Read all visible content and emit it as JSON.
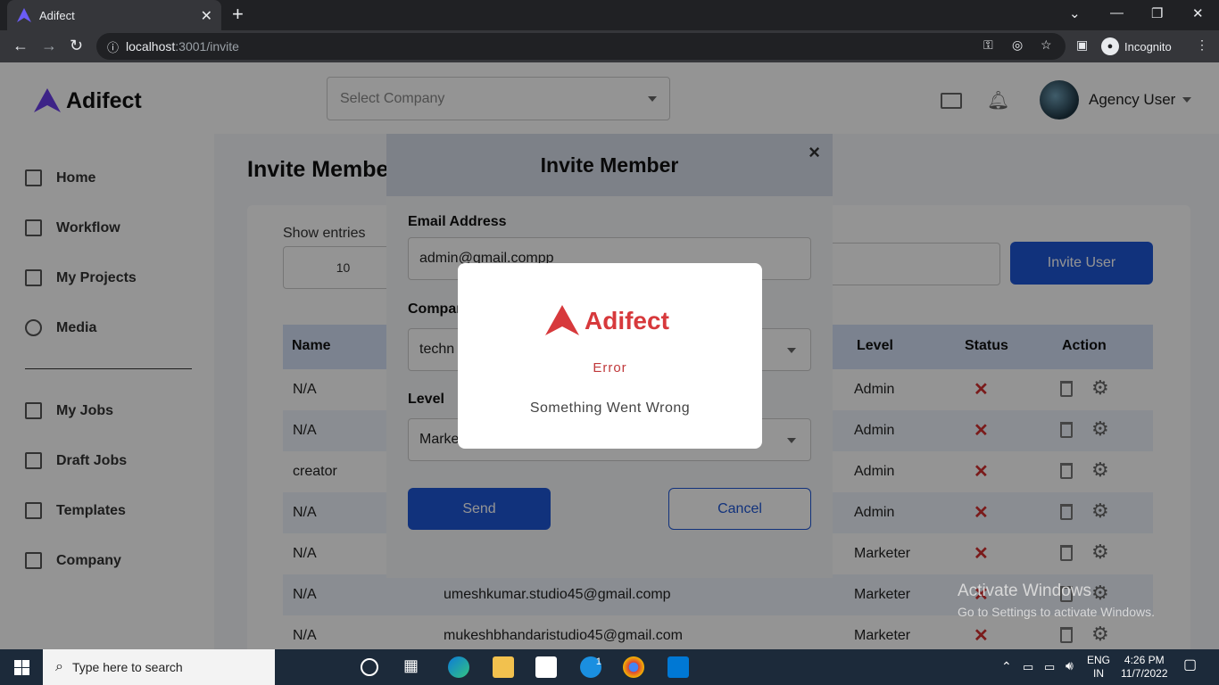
{
  "browser": {
    "tab_title": "Adifect",
    "url_host": "localhost",
    "url_path": ":3001/invite",
    "incognito_label": "Incognito"
  },
  "app": {
    "brand": "Adifect",
    "company_placeholder": "Select Company",
    "user_name": "Agency User",
    "sidebar": {
      "items": [
        "Home",
        "Workflow",
        "My Projects",
        "Media",
        "My Jobs",
        "Draft Jobs",
        "Templates",
        "Company"
      ]
    },
    "page_title": "Invite Member",
    "show_entries_label": "Show entries",
    "entries_value": "10",
    "invite_user_label": "Invite User",
    "table": {
      "headers": [
        "Name",
        "Level",
        "Status",
        "Action"
      ],
      "rows": [
        {
          "name": "N/A",
          "email": "",
          "level": "Admin"
        },
        {
          "name": "N/A",
          "email": "",
          "level": "Admin"
        },
        {
          "name": "creator",
          "email": "",
          "level": "Admin"
        },
        {
          "name": "N/A",
          "email": "",
          "level": "Admin"
        },
        {
          "name": "N/A",
          "email": "",
          "level": "Marketer"
        },
        {
          "name": "N/A",
          "email": "umeshkumar.studio45@gmail.comp",
          "level": "Marketer"
        },
        {
          "name": "N/A",
          "email": "mukeshbhandaristudio45@gmail.com",
          "level": "Marketer"
        }
      ]
    }
  },
  "modal": {
    "title": "Invite Member",
    "close_icon": "×",
    "email_label": "Email Address",
    "email_value": "admin@gmail.compp",
    "company_label": "Company",
    "company_value": "techn",
    "level_label": "Level",
    "level_value": "Marke",
    "send_label": "Send",
    "cancel_label": "Cancel"
  },
  "popup": {
    "brand": "Adifect",
    "title": "Error",
    "message": "Something Went Wrong",
    "accent_color": "#d7393c"
  },
  "watermark": {
    "line1": "Activate Windows",
    "line2": "Go to Settings to activate Windows."
  },
  "taskbar": {
    "search_placeholder": "Type here to search",
    "lang": "ENG",
    "region": "IN",
    "time": "4:26 PM",
    "date": "11/7/2022",
    "skype_badge": "1"
  },
  "colors": {
    "primary": "#1e56d6",
    "error": "#d32f2f",
    "table_header": "#d4e1f7"
  }
}
